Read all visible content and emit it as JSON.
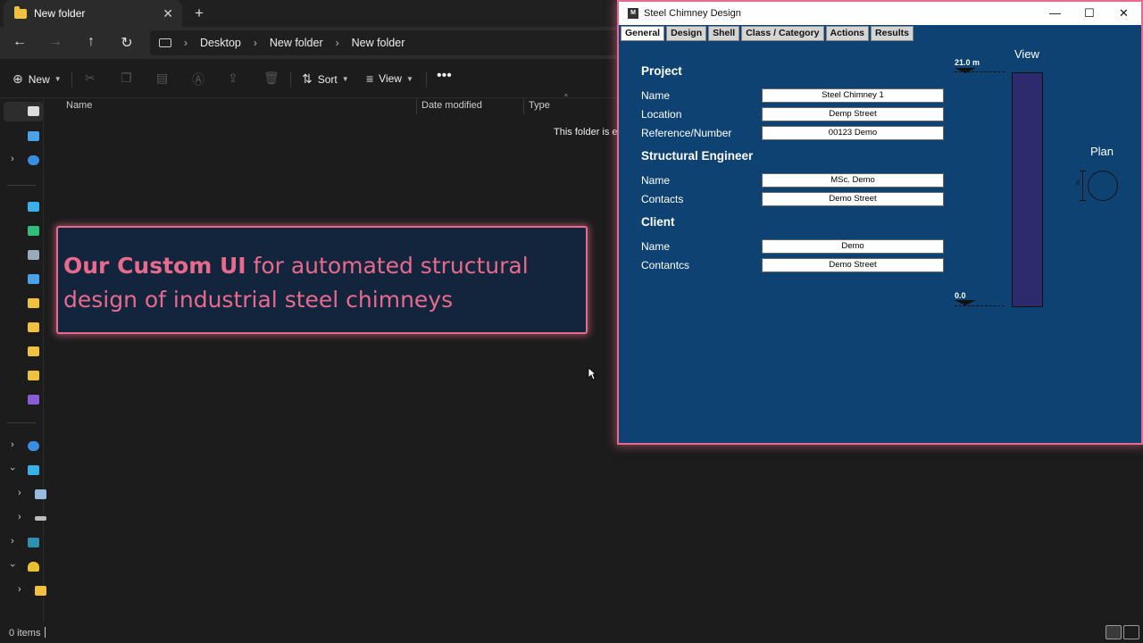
{
  "explorer": {
    "tab_title": "New folder",
    "breadcrumb": [
      "Desktop",
      "New folder",
      "New folder"
    ],
    "toolbar": {
      "new_label": "New",
      "sort_label": "Sort",
      "view_label": "View"
    },
    "columns": [
      "Name",
      "Date modified",
      "Type"
    ],
    "empty_message": "This folder is em",
    "status": "0 items"
  },
  "overlay": {
    "highlight": "Our Custom UI",
    "text": " for automated structural design of industrial steel chimneys"
  },
  "app": {
    "title": "Steel Chimney Design",
    "tabs": [
      "General",
      "Design",
      "Shell",
      "Class / Category",
      "Actions",
      "Results"
    ],
    "project": {
      "heading": "Project",
      "name_label": "Name",
      "name_value": "Steel Chimney 1",
      "location_label": "Location",
      "location_value": "Demp Street",
      "ref_label": "Reference/Number",
      "ref_value": "00123 Demo"
    },
    "engineer": {
      "heading": "Structural Engineer",
      "name_label": "Name",
      "name_value": "MSc. Demo",
      "contacts_label": "Contacts",
      "contacts_value": "Demo Street"
    },
    "client": {
      "heading": "Client",
      "name_label": "Name",
      "name_value": "Demo",
      "contacts_label": "Contantcs",
      "contacts_value": "Demo Street"
    },
    "drawing": {
      "view_label": "View",
      "plan_label": "Plan",
      "top_elevation": "21.0 m",
      "bottom_elevation": "0.0",
      "diameter_symbol": "d"
    },
    "accent_color": "#0e4272",
    "highlight_color": "#e86a8c"
  }
}
